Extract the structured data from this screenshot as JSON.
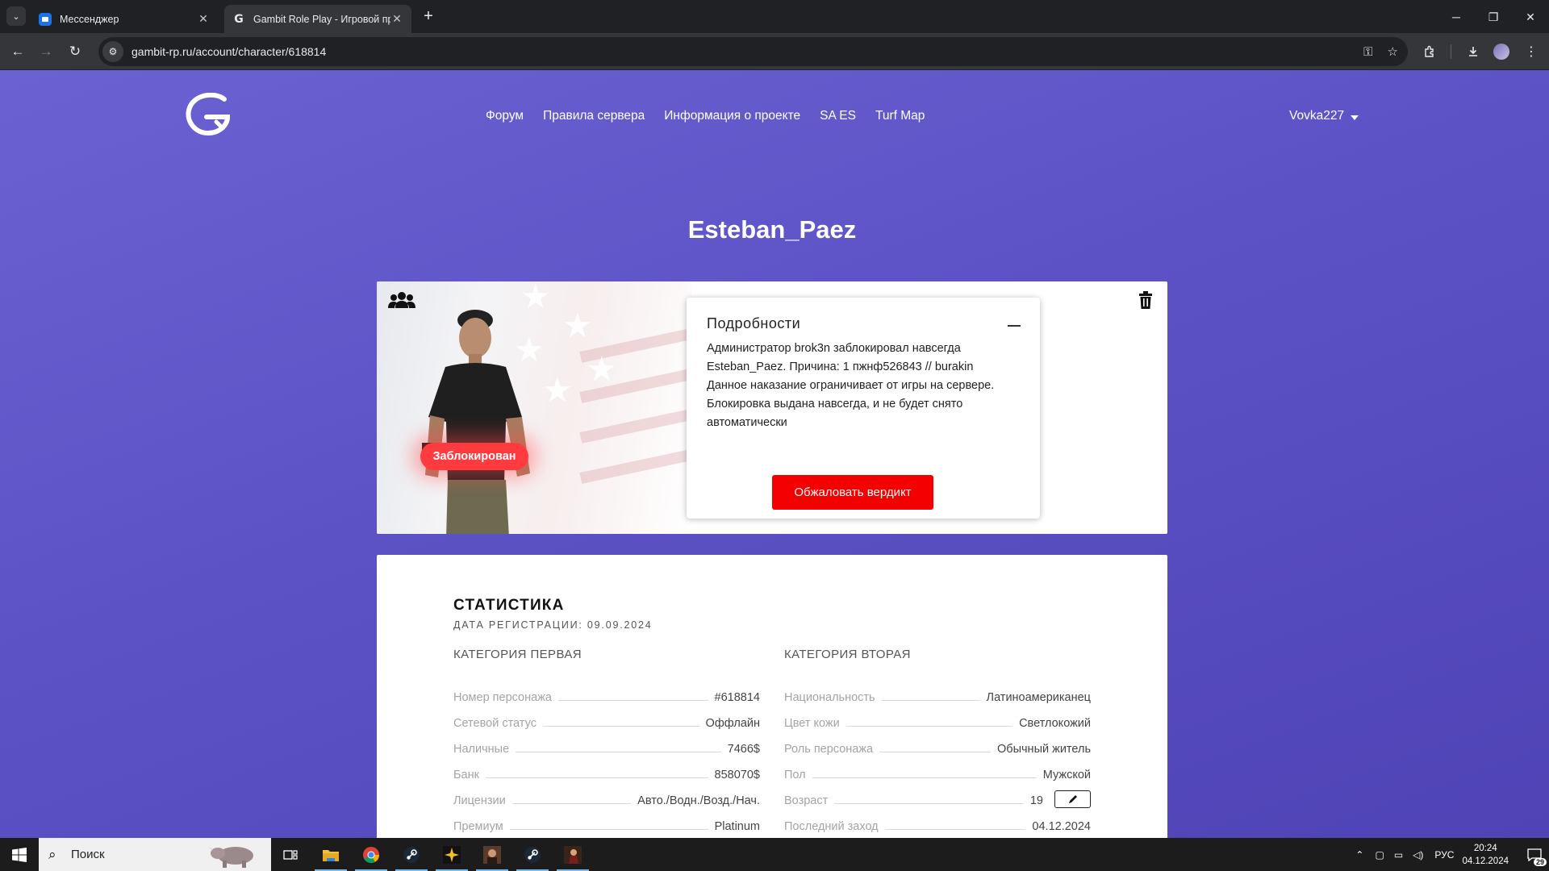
{
  "browser": {
    "tabs": [
      {
        "title": "Мессенджер",
        "icon": "messenger-icon",
        "active": false
      },
      {
        "title": "Gambit Role Play - Игровой пр",
        "icon": "gambit-favicon",
        "active": true
      }
    ],
    "url": "gambit-rp.ru/account/character/618814"
  },
  "site": {
    "nav": [
      "Форум",
      "Правила сервера",
      "Информация о проекте",
      "SA ES",
      "Turf Map"
    ],
    "user": "Vovka227"
  },
  "character": {
    "name": "Esteban_Paez",
    "status_badge": "Заблокирован",
    "details": {
      "title": "Подробности",
      "line1": "Администратор brok3n заблокировал навсегда Esteban_Paez. Причина: 1 пжнф526843 // burakin",
      "line2": "Данное наказание ограничивает от игры на сервере. Блокировка выдана навсегда, и не будет снято автоматически",
      "appeal_button": "Обжаловать вердикт"
    }
  },
  "stats": {
    "title": "СТАТИСТИКА",
    "registration": "ДАТА РЕГИСТРАЦИИ: 09.09.2024",
    "category1": {
      "heading": "КАТЕГОРИЯ ПЕРВАЯ",
      "rows": [
        {
          "label": "Номер персонажа",
          "value": "#618814"
        },
        {
          "label": "Сетевой статус",
          "value": "Оффлайн"
        },
        {
          "label": "Наличные",
          "value": "7466$"
        },
        {
          "label": "Банк",
          "value": "858070$"
        },
        {
          "label": "Лицензии",
          "value": "Авто./Водн./Возд./Нач."
        },
        {
          "label": "Премиум",
          "value": "Platinum"
        }
      ]
    },
    "category2": {
      "heading": "КАТЕГОРИЯ ВТОРАЯ",
      "rows": [
        {
          "label": "Национальность",
          "value": "Латиноамериканец"
        },
        {
          "label": "Цвет кожи",
          "value": "Светлокожий"
        },
        {
          "label": "Роль персонажа",
          "value": "Обычный житель"
        },
        {
          "label": "Пол",
          "value": "Мужской"
        },
        {
          "label": "Возраст",
          "value": "19"
        },
        {
          "label": "Последний заход",
          "value": "04.12.2024"
        }
      ]
    }
  },
  "taskbar": {
    "search_text": "Поиск",
    "language": "РУС",
    "time": "20:24",
    "date": "04.12.2024",
    "notifications": "29"
  },
  "colors": {
    "page_bg": "#5a4fc4",
    "badge_red": "#ff3b3f",
    "appeal_red": "#f40000"
  }
}
